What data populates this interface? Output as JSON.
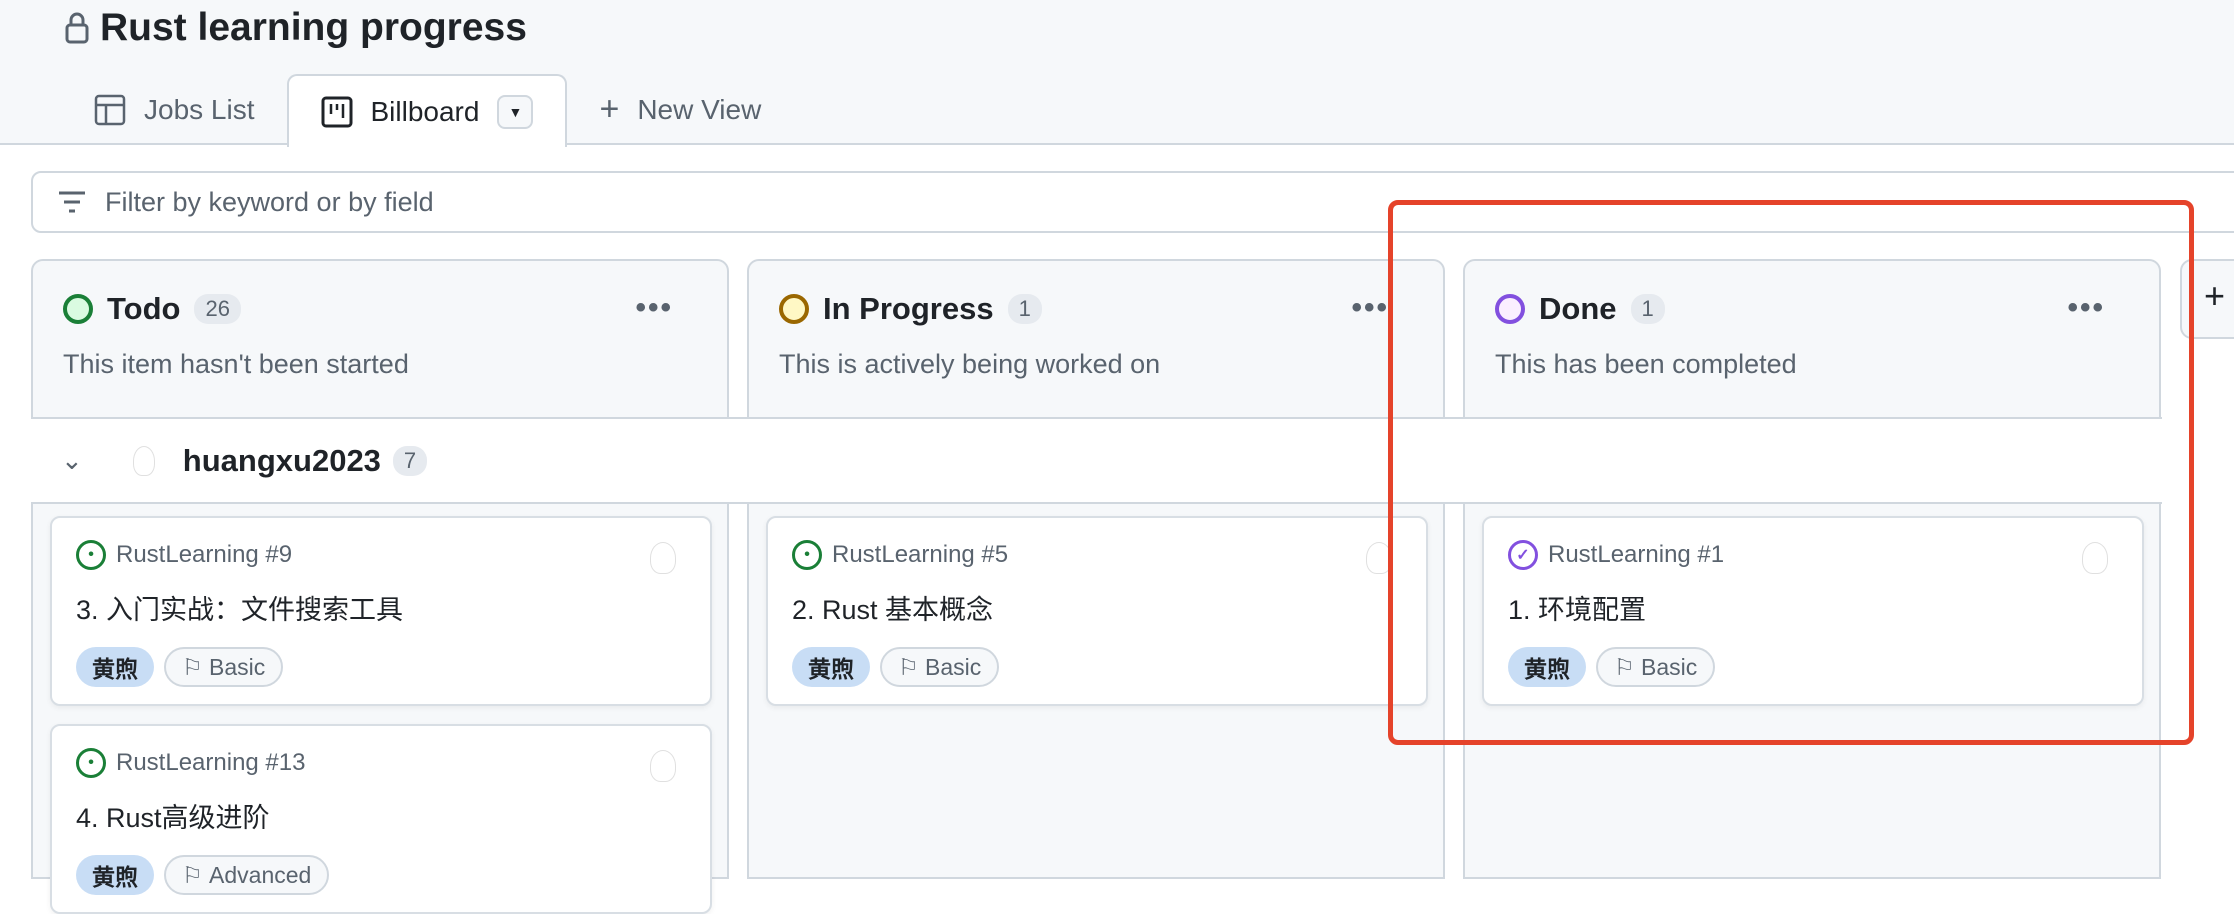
{
  "header": {
    "title": "Rust learning progress",
    "lock_icon": "lock-icon"
  },
  "tabs": [
    {
      "label": "Jobs List",
      "icon": "table-icon"
    },
    {
      "label": "Billboard",
      "icon": "board-icon",
      "active": true
    },
    {
      "label": "New View",
      "icon": "plus-icon"
    }
  ],
  "filter": {
    "placeholder": "Filter by keyword or by field"
  },
  "columns": [
    {
      "name": "Todo",
      "count": "26",
      "description": "This item hasn't been started",
      "color": "#1a7f37",
      "fill": "#dafbe1"
    },
    {
      "name": "In Progress",
      "count": "1",
      "description": "This is actively being worked on",
      "color": "#9a6700",
      "fill": "#fff8c5"
    },
    {
      "name": "Done",
      "count": "1",
      "description": "This has been completed",
      "color": "#8250df",
      "fill": "#fbefff"
    }
  ],
  "group": {
    "name": "huangxu2023",
    "count": "7"
  },
  "cards": [
    {
      "repo": "RustLearning #9",
      "title": "3. 入门实战：文件搜索工具",
      "labels": [
        "黄煦",
        "Basic"
      ]
    },
    {
      "repo": "RustLearning #13",
      "title": "4. Rust高级进阶",
      "labels": [
        "黄煦",
        "Advanced"
      ]
    },
    {
      "repo": "RustLearning #5",
      "title": "2. Rust 基本概念",
      "labels": [
        "黄煦",
        "Basic"
      ]
    },
    {
      "repo": "RustLearning #1",
      "title": "1. 环境配置",
      "labels": [
        "黄煦",
        "Basic"
      ]
    }
  ],
  "colors": {
    "highlight": "#e5432a",
    "label_blue": "#c8ddf5"
  }
}
